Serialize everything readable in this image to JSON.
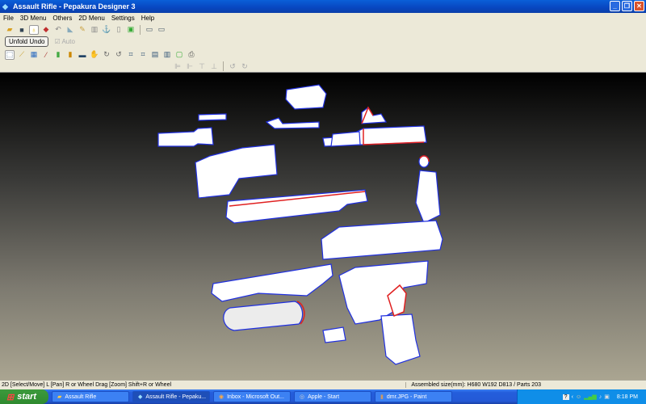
{
  "window": {
    "title": "Assault Rifle - Pepakura Designer 3"
  },
  "menu": [
    "File",
    "3D Menu",
    "Others",
    "2D Menu",
    "Settings",
    "Help"
  ],
  "toolbar2": {
    "unfold_undo": "Unfold Undo",
    "auto": "Auto"
  },
  "status": {
    "left": "2D [Select/Move] L [Pan] R or Wheel Drag [Zoom] Shift+R or Wheel",
    "right": "Assembled size(mm): H680 W192 D813 / Parts 203"
  },
  "taskbar": {
    "start": "start",
    "tasks": [
      "Assault Rifle",
      "Assault Rifle - Pepaku...",
      "Inbox - Microsoft Out...",
      "Apple - Start",
      "dmr.JPG - Paint"
    ],
    "clock": "8:18 PM"
  },
  "colors": {
    "part_edge": "#2030e0",
    "cut_edge": "#e02020",
    "canvas_top": "#000000",
    "canvas_bottom": "#aaa591"
  }
}
